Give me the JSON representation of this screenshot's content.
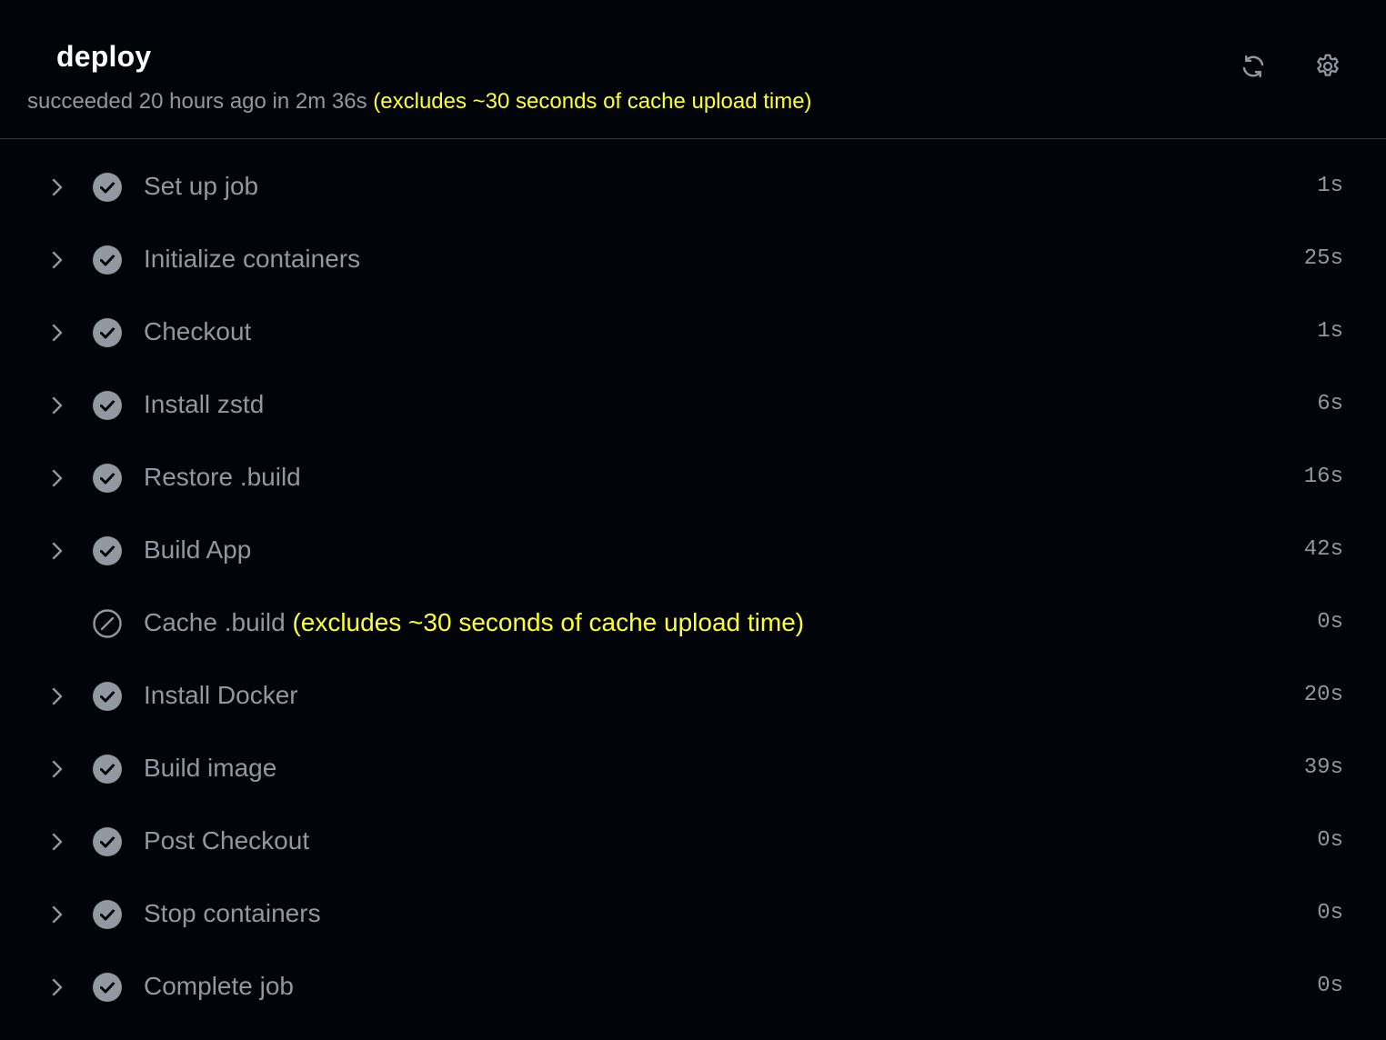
{
  "job": {
    "title": "deploy",
    "status_text": "succeeded 20 hours ago in 2m 36s",
    "note": "(excludes ~30 seconds of cache upload time)"
  },
  "header_actions": {
    "refresh_icon": "refresh-icon",
    "settings_icon": "gear-icon"
  },
  "colors": {
    "background": "#010409",
    "muted_text": "#9198a1",
    "note_yellow": "#ffff33",
    "success_icon": "#9198a1"
  },
  "steps": [
    {
      "name": "Set up job",
      "duration": "1s",
      "status": "success",
      "expandable": true
    },
    {
      "name": "Initialize containers",
      "duration": "25s",
      "status": "success",
      "expandable": true
    },
    {
      "name": "Checkout",
      "duration": "1s",
      "status": "success",
      "expandable": true
    },
    {
      "name": "Install zstd",
      "duration": "6s",
      "status": "success",
      "expandable": true
    },
    {
      "name": "Restore .build",
      "duration": "16s",
      "status": "success",
      "expandable": true
    },
    {
      "name": "Build App",
      "duration": "42s",
      "status": "success",
      "expandable": true
    },
    {
      "name": "Cache .build",
      "note": "(excludes ~30 seconds of cache upload time)",
      "duration": "0s",
      "status": "skipped",
      "expandable": false
    },
    {
      "name": "Install Docker",
      "duration": "20s",
      "status": "success",
      "expandable": true
    },
    {
      "name": "Build image",
      "duration": "39s",
      "status": "success",
      "expandable": true
    },
    {
      "name": "Post Checkout",
      "duration": "0s",
      "status": "success",
      "expandable": true
    },
    {
      "name": "Stop containers",
      "duration": "0s",
      "status": "success",
      "expandable": true
    },
    {
      "name": "Complete job",
      "duration": "0s",
      "status": "success",
      "expandable": true
    }
  ]
}
